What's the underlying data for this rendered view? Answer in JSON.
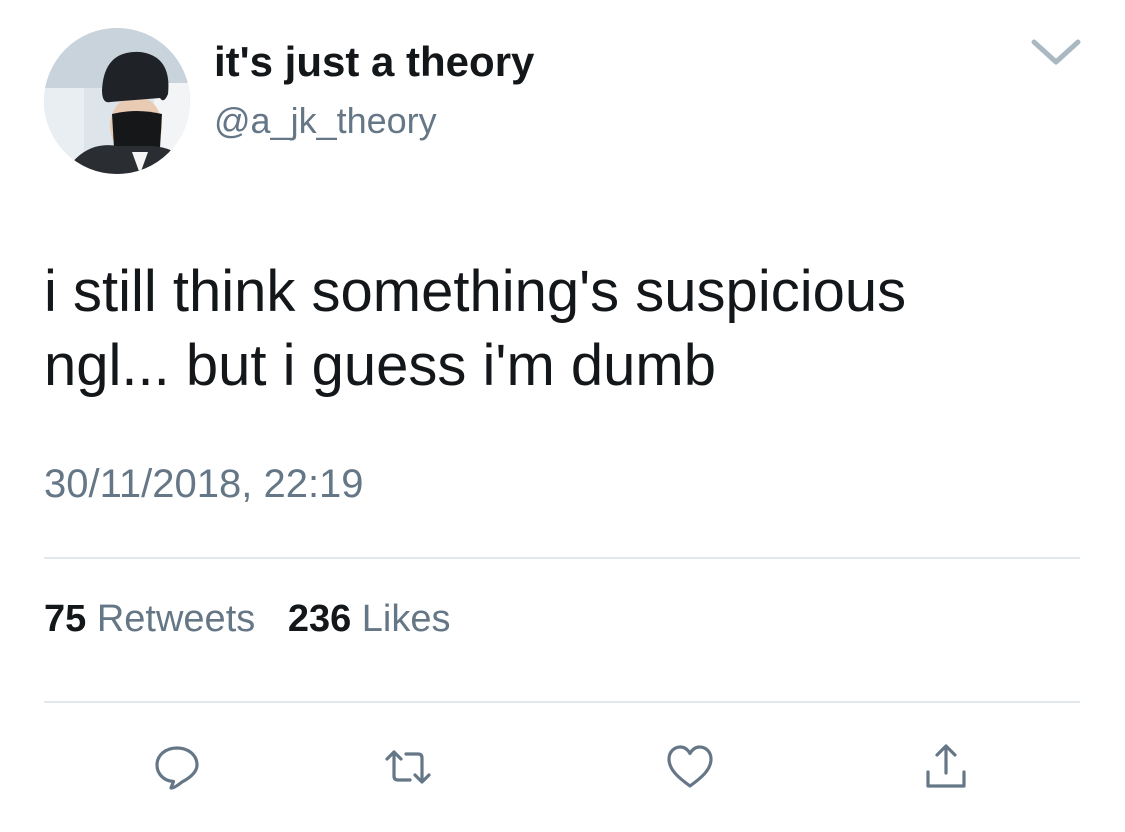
{
  "tweet": {
    "author": {
      "display_name": "it's just a theory",
      "handle": "@a_jk_theory"
    },
    "text_lines": [
      "i still think something's suspicious",
      "ngl... but i guess i'm dumb"
    ],
    "timestamp": "30/11/2018, 22:19",
    "stats": {
      "retweets_count": "75",
      "retweets_label": "Retweets",
      "likes_count": "236",
      "likes_label": "Likes"
    }
  },
  "icons": {
    "menu": "chevron-down-icon",
    "reply": "reply-icon",
    "retweet": "retweet-icon",
    "like": "heart-icon",
    "share": "share-icon"
  },
  "colors": {
    "text_primary": "#14171a",
    "text_secondary": "#657786",
    "divider": "#e1e8ed"
  }
}
